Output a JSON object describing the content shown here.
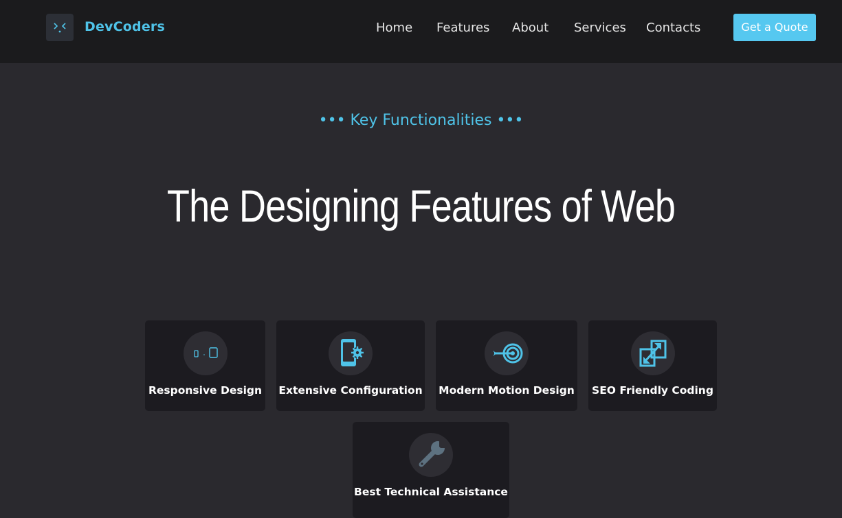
{
  "header": {
    "brand": "DevCoders",
    "logo_icon": "code-brackets-icon",
    "nav": [
      {
        "label": "Home"
      },
      {
        "label": "Features"
      },
      {
        "label": "About"
      },
      {
        "label": "Services"
      },
      {
        "label": "Contacts"
      }
    ],
    "cta_label": "Get a Quote"
  },
  "hero": {
    "kicker": "••• Key Functionalities •••",
    "title": "The Designing Features of Web"
  },
  "features": [
    {
      "label": "Responsive Design",
      "icon": "responsive-devices-icon"
    },
    {
      "label": "Extensive Configuration",
      "icon": "phone-settings-icon"
    },
    {
      "label": "Modern Motion Design",
      "icon": "target-arrow-icon"
    },
    {
      "label": "SEO Friendly Coding",
      "icon": "transfer-arrows-icon"
    },
    {
      "label": "Best Technical Assistance",
      "icon": "wrench-icon"
    }
  ],
  "colors": {
    "accent": "#4fc3e8",
    "button": "#56c8f0",
    "page_bg": "#2a292e",
    "header_bg": "#1b1b1d",
    "card_bg": "#1c1b20"
  }
}
